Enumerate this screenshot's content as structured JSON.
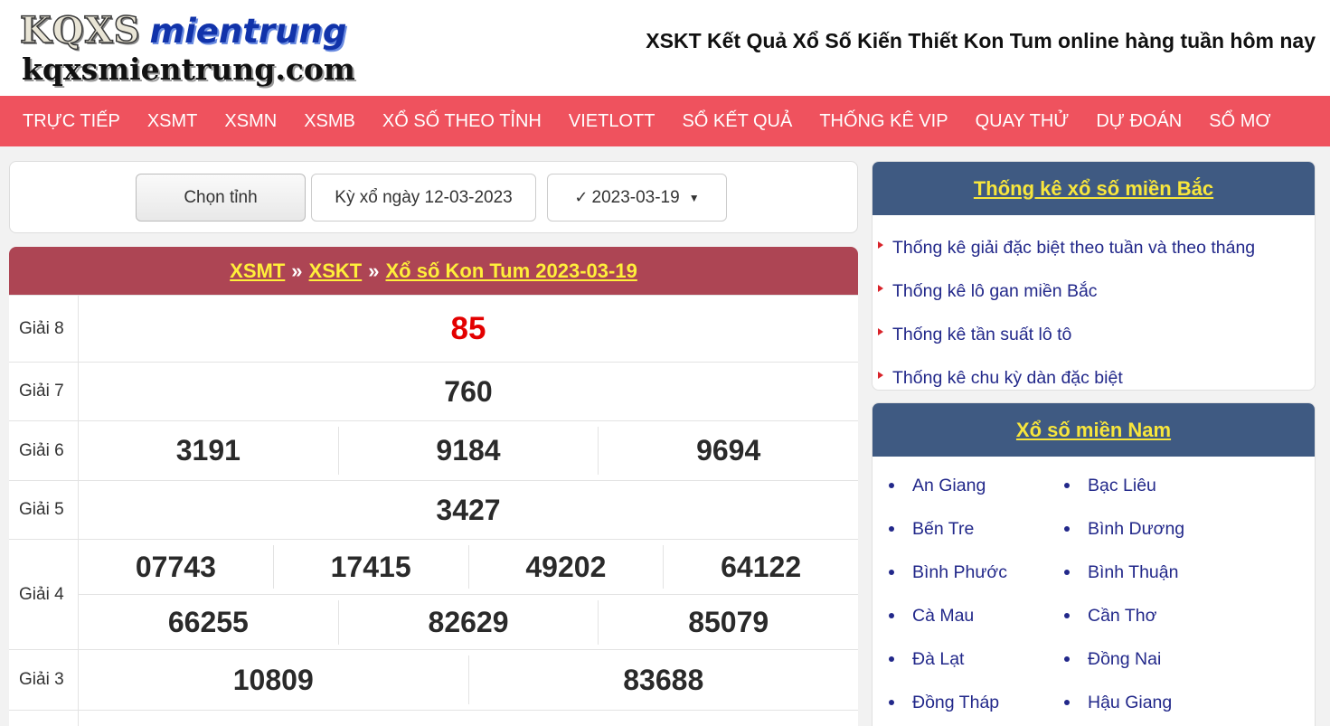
{
  "header": {
    "logo_kqxs": "KQXS",
    "logo_mientrung": "mientrung",
    "logo_domain": "kqxsmientrung.com",
    "title": "XSKT Kết Quả Xổ Số Kiến Thiết Kon Tum online hàng tuần hôm nay"
  },
  "nav": [
    "TRỰC TIẾP",
    "XSMT",
    "XSMN",
    "XSMB",
    "XỔ SỐ THEO TỈNH",
    "VIETLOTT",
    "SỔ KẾT QUẢ",
    "THỐNG KÊ VIP",
    "QUAY THỬ",
    "DỰ ĐOÁN",
    "SỔ MƠ"
  ],
  "filter": {
    "province_button": "Chọn tỉnh",
    "date_label": "Kỳ xổ ngày 12-03-2023",
    "date_selected": "2023-03-19"
  },
  "results": {
    "breadcrumb": [
      "XSMT",
      "XSKT",
      "Xổ số Kon Tum 2023-03-19"
    ],
    "breadcrumb_sep": "»",
    "rows": [
      {
        "label": "Giải 8",
        "values": [
          "85"
        ]
      },
      {
        "label": "Giải 7",
        "values": [
          "760"
        ]
      },
      {
        "label": "Giải 6",
        "values": [
          "3191",
          "9184",
          "9694"
        ]
      },
      {
        "label": "Giải 5",
        "values": [
          "3427"
        ]
      },
      {
        "label": "Giải 4",
        "values": [
          "07743",
          "17415",
          "49202",
          "64122"
        ],
        "values2": [
          "66255",
          "82629",
          "85079"
        ]
      },
      {
        "label": "Giải 3",
        "values": [
          "10809",
          "83688"
        ]
      }
    ]
  },
  "sidebar": {
    "stats_title": "Thống kê xổ số miền Bắc",
    "stats_links": [
      "Thống kê giải đặc biệt theo tuần và theo tháng",
      "Thống kê lô gan miền Bắc",
      "Thống kê tần suất lô tô",
      "Thống kê chu kỳ dàn đặc biệt"
    ],
    "south_title": "Xổ số miền Nam",
    "south_provinces": [
      "An Giang",
      "Bạc Liêu",
      "Bến Tre",
      "Bình Dương",
      "Bình Phước",
      "Bình Thuận",
      "Cà Mau",
      "Cần Thơ",
      "Đà Lạt",
      "Đồng Nai",
      "Đồng Tháp",
      "Hậu Giang"
    ]
  },
  "colors": {
    "nav_bg": "#ef525e",
    "results_head_bg": "#ad4554",
    "link_yellow": "#ffef3a",
    "sidebar_head_bg": "#3f5a82",
    "special_prize": "#e30000",
    "link_blue": "#22288a"
  }
}
